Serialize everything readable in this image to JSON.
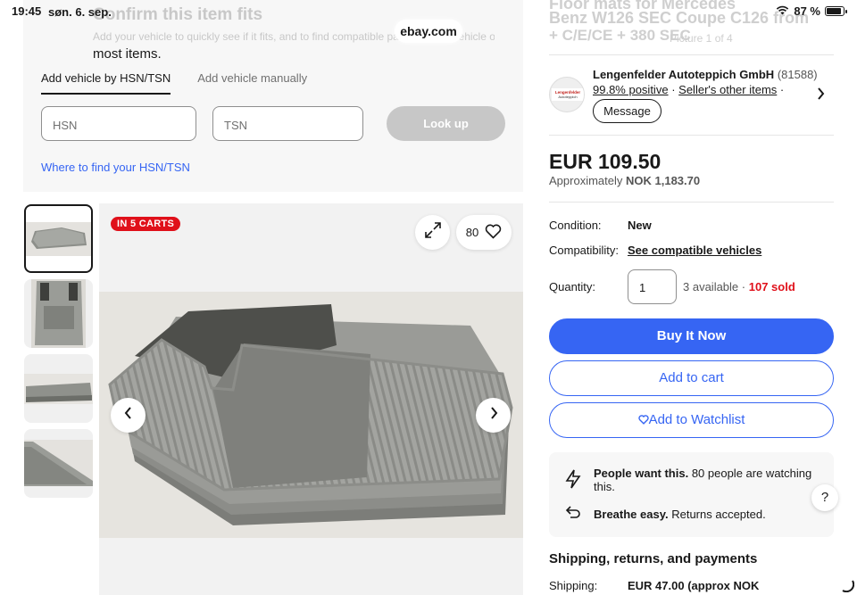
{
  "status_bar": {
    "time": "19:45",
    "date": "søn. 6. sep.",
    "battery": "87 %",
    "battery_level": 0.87
  },
  "browser": {
    "url": "ebay.com"
  },
  "compat": {
    "faded_heading": "Confirm this item fits",
    "faded_text": "Add your vehicle to quickly see if it fits, and to find compatible parts for your vehicle on",
    "most_items": "most items.",
    "tabs": [
      {
        "label": "Add vehicle by HSN/TSN",
        "active": true
      },
      {
        "label": "Add vehicle manually",
        "active": false
      }
    ],
    "hsn_placeholder": "HSN",
    "tsn_placeholder": "TSN",
    "lookup_label": "Look up",
    "where_link": "Where to find your HSN/TSN"
  },
  "gallery": {
    "carts_badge": "IN 5 CARTS",
    "watch_count": "80",
    "thumbnail_count": 4,
    "selected_thumbnail": 1
  },
  "listing": {
    "faded_title_1": "Floor mats for Mercedes",
    "faded_title_2": "Benz W126 SEC Coupe C126 from",
    "faded_title_3": "+ C/E/CE + 380 SEC",
    "faded_subtitle": "Picture 1 of 4"
  },
  "seller": {
    "name": "Lengenfelder Autoteppich GmbH",
    "feedback_count": "(81588)",
    "positive": "99.8% positive",
    "other_items": "Seller's other items",
    "separator": "·",
    "message_label": "Message",
    "avatar_text": "Lengenfelder Autoteppich"
  },
  "price": {
    "amount": "EUR 109.50",
    "approx_prefix": "Approximately",
    "approx_value": "NOK 1,183.70"
  },
  "details": {
    "condition_label": "Condition:",
    "condition_value": "New",
    "compat_label": "Compatibility:",
    "compat_value": "See compatible vehicles",
    "quantity_label": "Quantity:",
    "quantity_value": "1",
    "available": "3 available",
    "sold": "107 sold"
  },
  "actions": {
    "buy_now": "Buy It Now",
    "add_cart": "Add to cart",
    "add_watchlist": "Add to Watchlist"
  },
  "highlights": {
    "watch_bold": "People want this.",
    "watch_text": "80 people are watching this.",
    "returns_bold": "Breathe easy.",
    "returns_text": "Returns accepted."
  },
  "shipping": {
    "section_title": "Shipping, returns, and payments",
    "label": "Shipping:",
    "value": "EUR 47.00 (approx NOK"
  },
  "help_label": "?",
  "colors": {
    "accent": "#3665f3",
    "badge_red": "#e0101a",
    "text": "#191919"
  }
}
